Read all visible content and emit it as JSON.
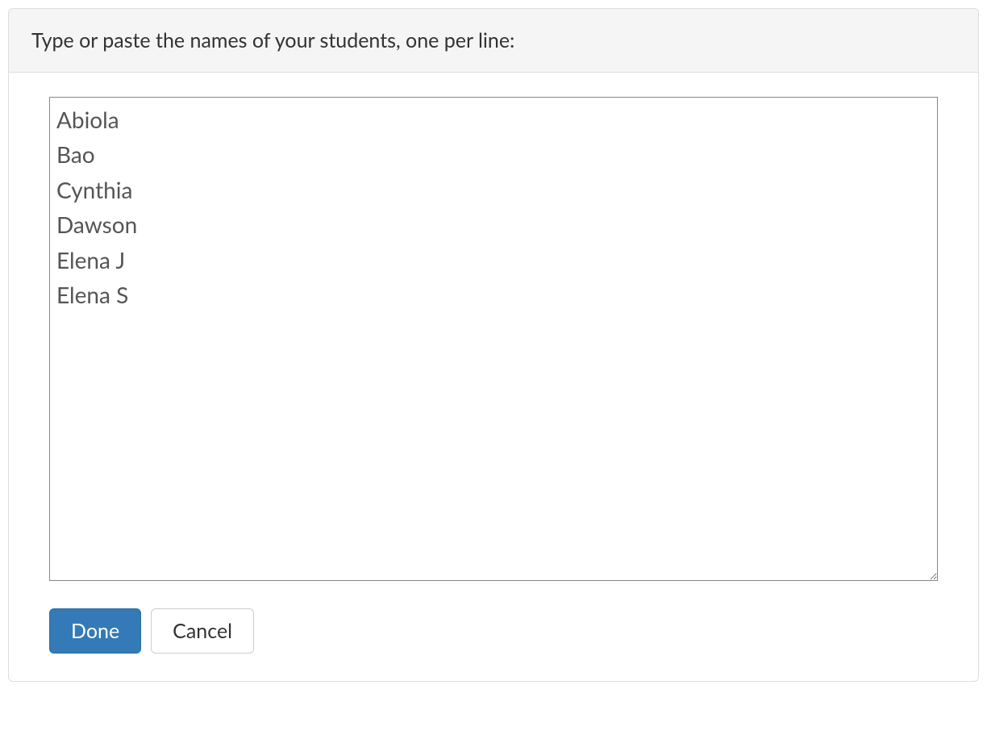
{
  "header": {
    "title": "Type or paste the names of your students, one per line:"
  },
  "form": {
    "students_value": "Abiola\nBao\nCynthia\nDawson\nElena J\nElena S"
  },
  "buttons": {
    "done_label": "Done",
    "cancel_label": "Cancel"
  }
}
